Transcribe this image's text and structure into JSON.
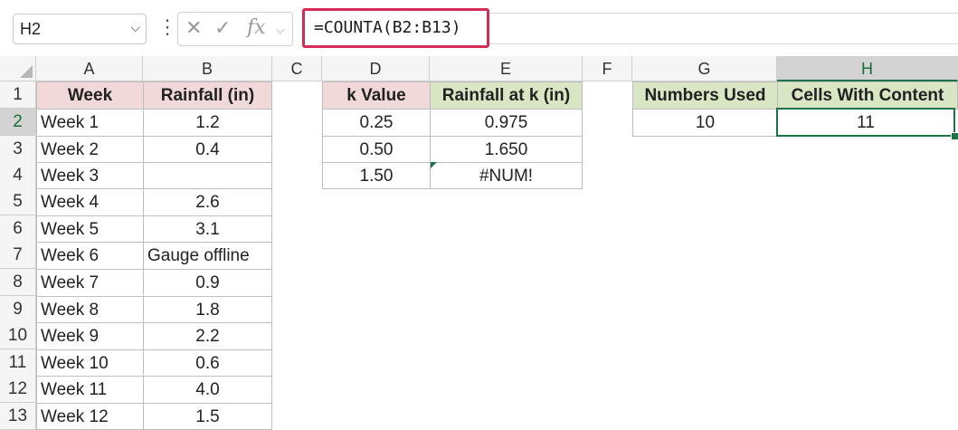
{
  "formula_bar": {
    "name_box": "H2",
    "formula": "=COUNTA(B2:B13)"
  },
  "columns": [
    "A",
    "B",
    "C",
    "D",
    "E",
    "F",
    "G",
    "H"
  ],
  "rows": [
    "1",
    "2",
    "3",
    "4",
    "5",
    "6",
    "7",
    "8",
    "9",
    "10",
    "11",
    "12",
    "13"
  ],
  "table1": {
    "headers": [
      "Week",
      "Rainfall (in)"
    ],
    "rows": [
      [
        "Week 1",
        "1.2"
      ],
      [
        "Week 2",
        "0.4"
      ],
      [
        "Week 3",
        ""
      ],
      [
        "Week 4",
        "2.6"
      ],
      [
        "Week 5",
        "3.1"
      ],
      [
        "Week 6",
        "Gauge offline"
      ],
      [
        "Week 7",
        "0.9"
      ],
      [
        "Week 8",
        "1.8"
      ],
      [
        "Week 9",
        "2.2"
      ],
      [
        "Week 10",
        "0.6"
      ],
      [
        "Week 11",
        "4.0"
      ],
      [
        "Week 12",
        "1.5"
      ]
    ]
  },
  "table2": {
    "headers": [
      "k Value",
      "Rainfall at k (in)"
    ],
    "rows": [
      [
        "0.25",
        "0.975"
      ],
      [
        "0.50",
        "1.650"
      ],
      [
        "1.50",
        "#NUM!"
      ]
    ]
  },
  "table3": {
    "headers": [
      "Numbers Used",
      "Cells With Content"
    ],
    "values": [
      "10",
      "11"
    ]
  },
  "colors": {
    "header_pink": "#f2d9d9",
    "header_green": "#d8e6c4",
    "selection": "#1e7145",
    "formula_highlight": "#d42c52"
  }
}
